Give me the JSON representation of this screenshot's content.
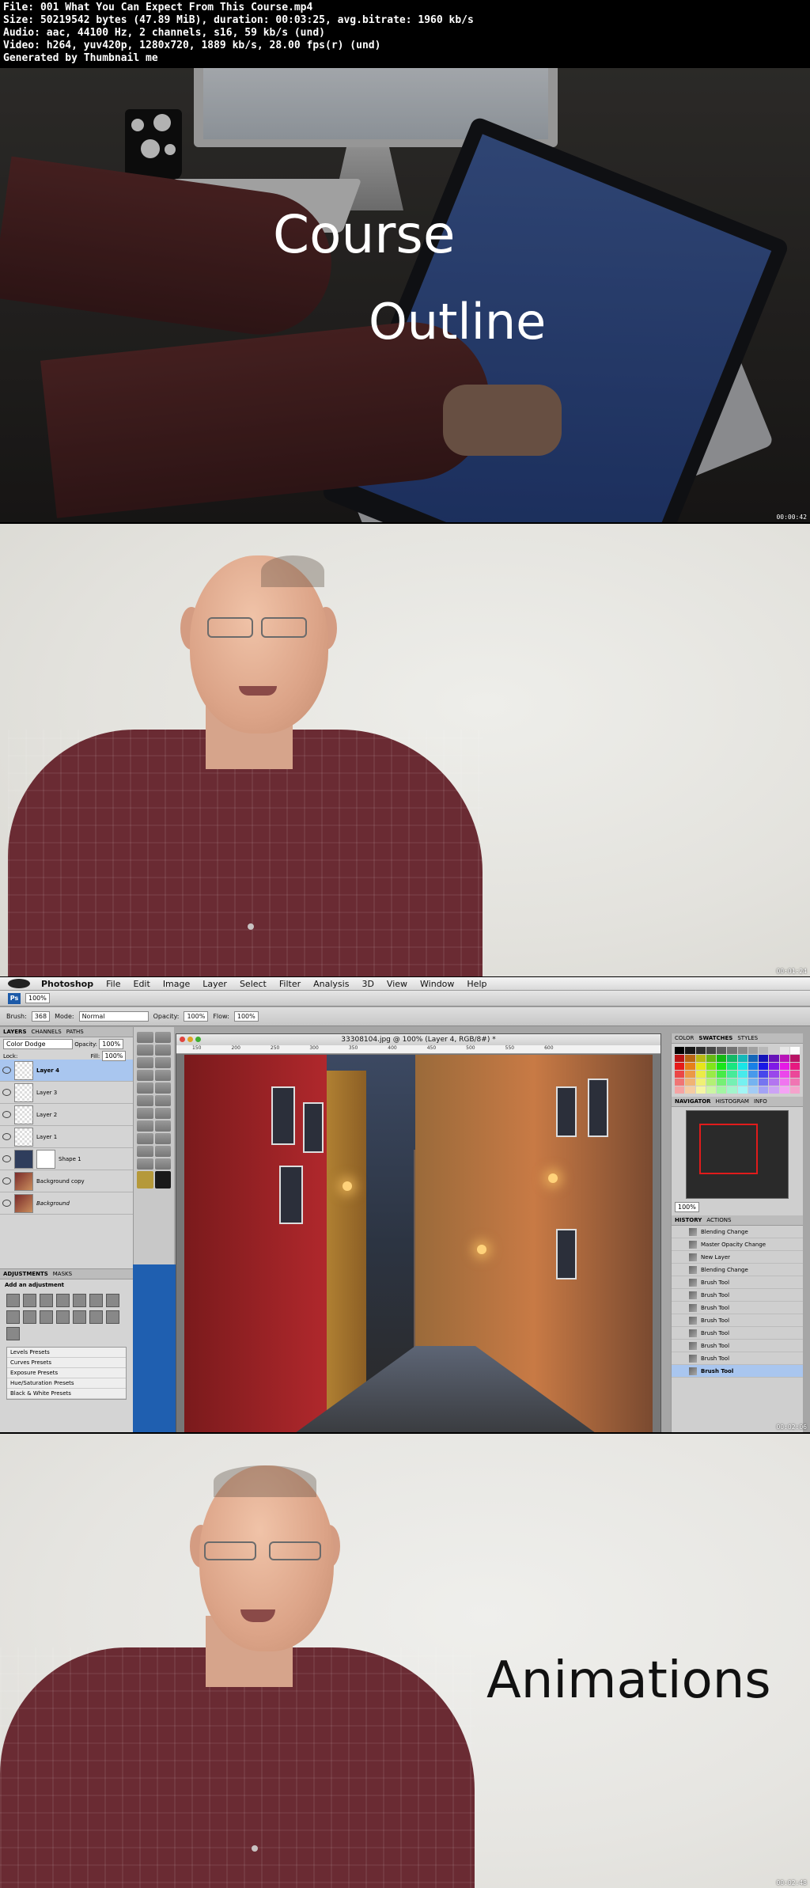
{
  "header": {
    "line1": "File: 001 What You Can Expect From This Course.mp4",
    "line2": "Size: 50219542 bytes (47.89 MiB), duration: 00:03:25, avg.bitrate: 1960 kb/s",
    "line3": "Audio: aac, 44100 Hz, 2 channels, s16, 59 kb/s (und)",
    "line4": "Video: h264, yuv420p, 1280x720, 1889 kb/s, 28.00 fps(r) (und)",
    "line5": "Generated by Thumbnail me"
  },
  "frame1": {
    "title_line1": "Course",
    "title_line2": "Outline",
    "timestamp": "00:00:42"
  },
  "frame2": {
    "timestamp": "00:01:24"
  },
  "frame3": {
    "timestamp": "00:02:06",
    "menu": [
      "Photoshop",
      "File",
      "Edit",
      "Image",
      "Layer",
      "Select",
      "Filter",
      "Analysis",
      "3D",
      "View",
      "Window",
      "Help"
    ],
    "app_bar": {
      "zoom": "100%"
    },
    "options": {
      "brush_label": "Brush:",
      "brush_size": "368",
      "mode_label": "Mode:",
      "mode": "Normal",
      "opacity_label": "Opacity:",
      "opacity": "100%",
      "flow_label": "Flow:",
      "flow": "100%"
    },
    "layers_panel": {
      "tabs": [
        "LAYERS",
        "CHANNELS",
        "PATHS"
      ],
      "blend_mode": "Color Dodge",
      "opacity_label": "Opacity:",
      "opacity": "100%",
      "lock_label": "Lock:",
      "fill_label": "Fill:",
      "fill": "100%",
      "layers": [
        "Layer 4",
        "Layer 3",
        "Layer 2",
        "Layer 1",
        "Shape 1",
        "Background copy",
        "Background"
      ]
    },
    "adjustments_panel": {
      "tabs": [
        "ADJUSTMENTS",
        "MASKS"
      ],
      "heading": "Add an adjustment",
      "presets": [
        "Levels Presets",
        "Curves Presets",
        "Exposure Presets",
        "Hue/Saturation Presets",
        "Black & White Presets"
      ]
    },
    "document": {
      "title": "33308104.jpg @ 100% (Layer 4, RGB/8#) *",
      "ruler": [
        "150",
        "200",
        "250",
        "300",
        "350",
        "400",
        "450",
        "500",
        "550",
        "600"
      ]
    },
    "right_panels": {
      "color_tabs": [
        "COLOR",
        "SWATCHES",
        "STYLES"
      ],
      "nav_tabs": [
        "NAVIGATOR",
        "HISTOGRAM",
        "INFO"
      ],
      "nav_zoom": "100%",
      "history_tabs": [
        "HISTORY",
        "ACTIONS"
      ],
      "history": [
        "Blending Change",
        "Master Opacity Change",
        "New Layer",
        "Blending Change",
        "Brush Tool",
        "Brush Tool",
        "Brush Tool",
        "Brush Tool",
        "Brush Tool",
        "Brush Tool",
        "Brush Tool",
        "Brush Tool"
      ]
    }
  },
  "frame4": {
    "title": "Animations",
    "timestamp": "00:02:48"
  },
  "colors": {
    "ps_selection": "#a9c6ef",
    "nav_frame": "#e01b1b",
    "shirt": "#6a2b33"
  }
}
